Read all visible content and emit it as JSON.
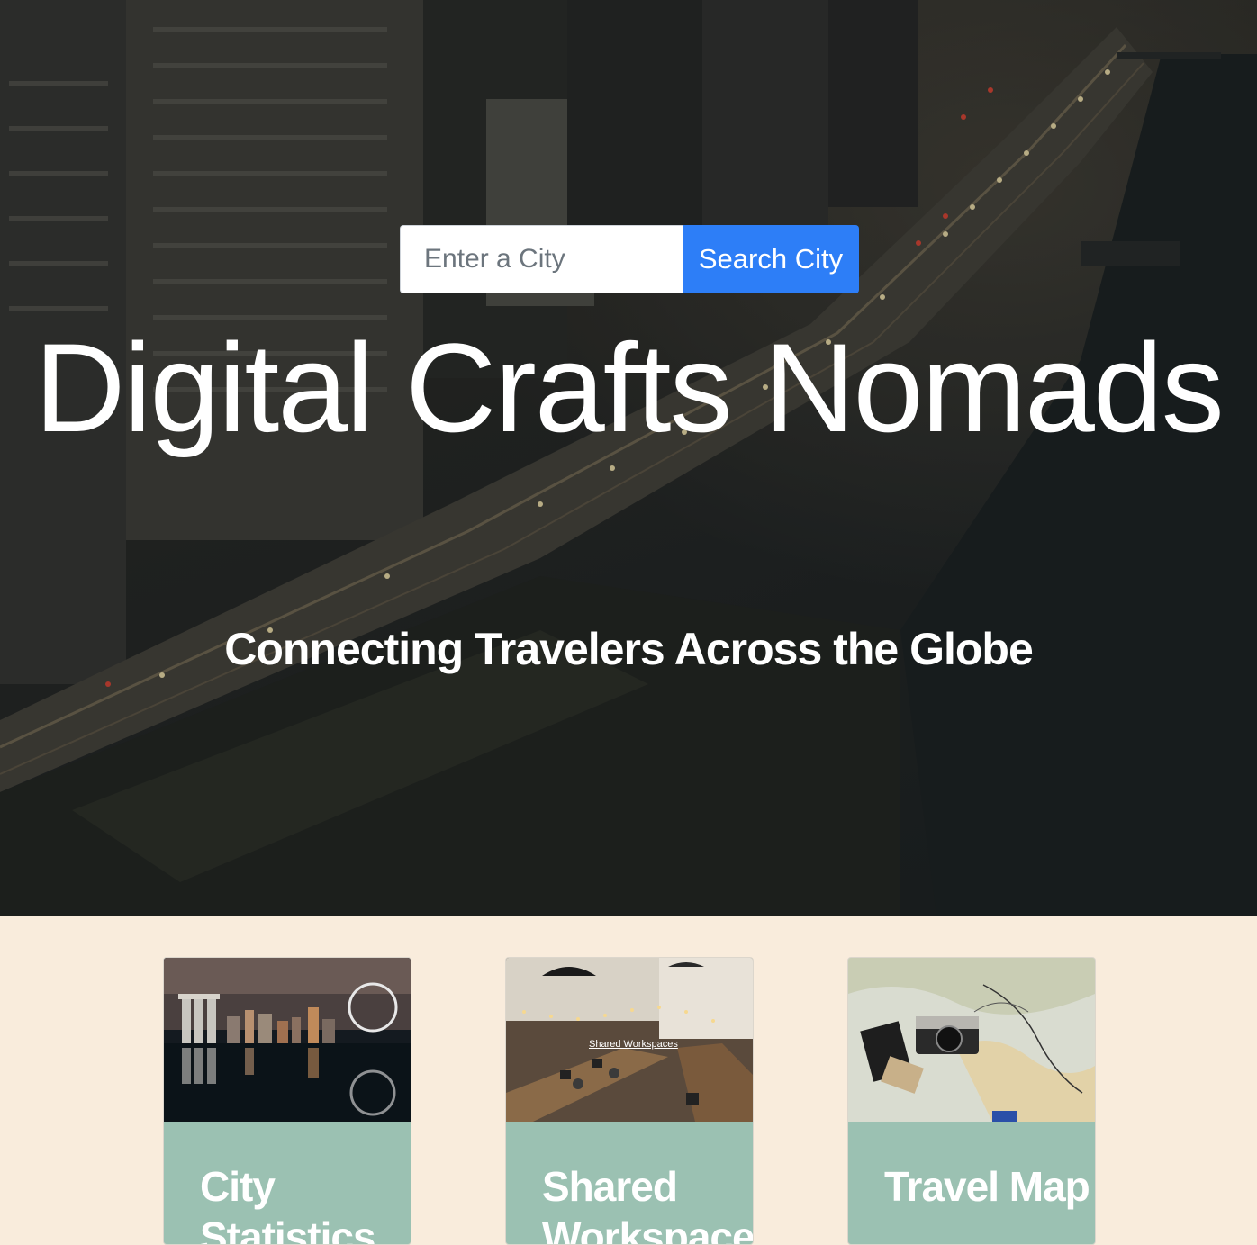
{
  "search": {
    "placeholder": "Enter a City",
    "button_label": "Search City"
  },
  "hero": {
    "title": "Digital Crafts Nomads",
    "subtitle": "Connecting Travelers Across the Globe"
  },
  "cards": [
    {
      "title": "City Statistics",
      "image_icon": "city-skyline-image"
    },
    {
      "title": "Shared Workspaces",
      "image_icon": "workspace-image",
      "image_caption": "Shared Workspaces"
    },
    {
      "title": "Travel Map",
      "image_icon": "travel-map-image"
    }
  ],
  "colors": {
    "page_background": "#f9ecdc",
    "card_background": "#9bc1b2",
    "button_primary": "#2d7ef7",
    "text_light": "#ffffff"
  }
}
